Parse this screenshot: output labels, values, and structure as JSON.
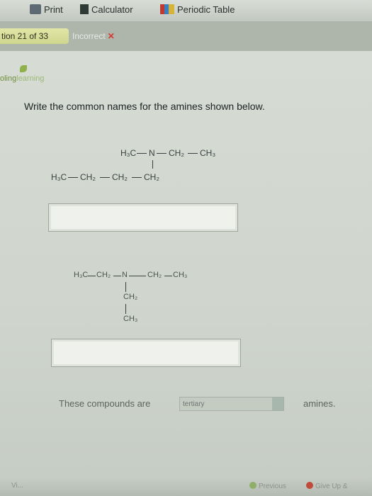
{
  "toolbar": {
    "print_label": "Print",
    "calculator_label": "Calculator",
    "periodic_label": "Periodic Table"
  },
  "question_bar": {
    "position_label": "tion 21 of 33",
    "status_label": "Incorrect",
    "status_mark": "✕"
  },
  "brand": {
    "part1": "oling",
    "part2": "learning"
  },
  "prompt": "Write the common names for the amines shown below.",
  "structure1": {
    "h3c": "H₃C",
    "n": "N",
    "ch2_a": "CH₂",
    "ch3": "CH₃",
    "h3c_b": "H₃C",
    "ch2_b": "CH₂",
    "ch2_c": "CH₂",
    "ch2_d": "CH₂"
  },
  "structure2": {
    "h3c": "H₃C",
    "ch2_a": "CH₂",
    "n": "N",
    "ch2_b": "CH₂",
    "ch3": "CH₃",
    "ch2_down": "CH₂",
    "ch3_down": "CH₃"
  },
  "answer1_value": "",
  "answer2_value": "",
  "footer": {
    "lead": "These compounds are",
    "selected": "tertiary",
    "tail": "amines."
  },
  "bottom_nav": {
    "left_label": "Vi...",
    "prev_label": "Previous",
    "give_up_label": "Give Up &"
  }
}
